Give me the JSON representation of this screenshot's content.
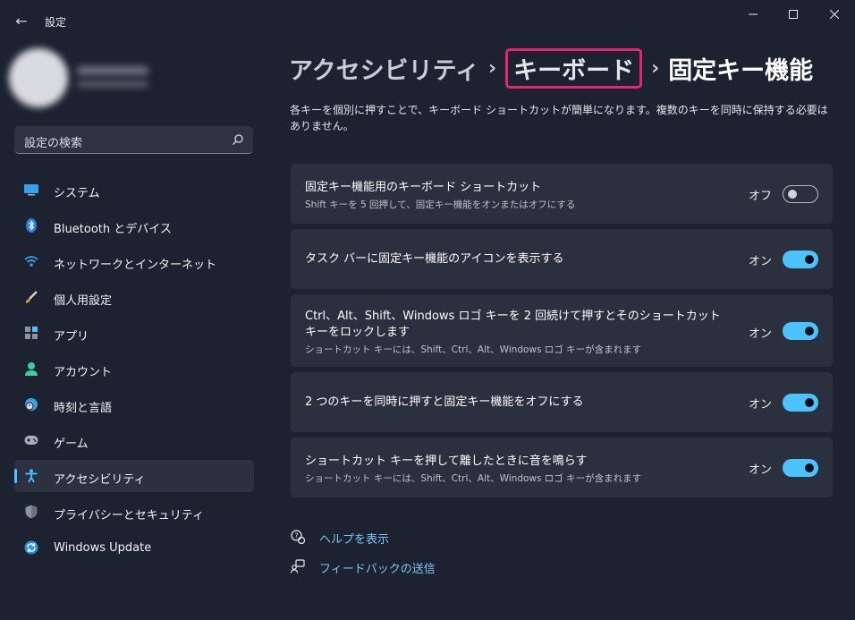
{
  "window": {
    "app_title": "設定",
    "back_glyph": "←",
    "minimize_glyph": "—",
    "maximize_glyph": "☐",
    "close_glyph": "✕"
  },
  "search": {
    "placeholder": "設定の検索"
  },
  "sidebar": {
    "items": [
      {
        "label": "システム",
        "icon": "system-icon"
      },
      {
        "label": "Bluetooth とデバイス",
        "icon": "bluetooth-icon"
      },
      {
        "label": "ネットワークとインターネット",
        "icon": "network-icon"
      },
      {
        "label": "個人用設定",
        "icon": "brush-icon"
      },
      {
        "label": "アプリ",
        "icon": "apps-icon"
      },
      {
        "label": "アカウント",
        "icon": "account-icon"
      },
      {
        "label": "時刻と言語",
        "icon": "time-language-icon"
      },
      {
        "label": "ゲーム",
        "icon": "gamepad-icon"
      },
      {
        "label": "アクセシビリティ",
        "icon": "accessibility-icon",
        "active": true
      },
      {
        "label": "プライバシーとセキュリティ",
        "icon": "shield-icon"
      },
      {
        "label": "Windows Update",
        "icon": "update-icon"
      }
    ]
  },
  "breadcrumb": {
    "level1": "アクセシビリティ",
    "level2": "キーボード",
    "current": "固定キー機能",
    "separator": "›"
  },
  "description": "各キーを個別に押すことで、キーボード ショートカットが簡単になります。複数のキーを同時に保持する必要はありません。",
  "settings": [
    {
      "title": "固定キー機能用のキーボード ショートカット",
      "subtitle": "Shift キーを 5 回押して、固定キー機能をオンまたはオフにする",
      "state_label": "オフ",
      "on": false
    },
    {
      "title": "タスク バーに固定キー機能のアイコンを表示する",
      "subtitle": "",
      "state_label": "オン",
      "on": true
    },
    {
      "title_line1": "Ctrl、Alt、Shift、Windows ロゴ キーを 2 回続けて押すとそのショートカット",
      "title_line2": "キーをロックします",
      "subtitle": "ショートカット キーには、Shift、Ctrl、Alt、Windows ロゴ キーが含まれます",
      "state_label": "オン",
      "on": true
    },
    {
      "title": "2 つのキーを同時に押すと固定キー機能をオフにする",
      "subtitle": "",
      "state_label": "オン",
      "on": true
    },
    {
      "title": "ショートカット キーを押して離したときに音を鳴らす",
      "subtitle": "ショートカット キーには、Shift、Ctrl、Alt、Windows ロゴ キーが含まれます",
      "state_label": "オン",
      "on": true
    }
  ],
  "links": {
    "help": "ヘルプを表示",
    "feedback": "フィードバックの送信"
  },
  "colors": {
    "accent": "#4cc2ff",
    "highlight_box": "#e5266e",
    "background": "#1c2230",
    "card": "#2a303d",
    "link": "#79c7f5"
  }
}
